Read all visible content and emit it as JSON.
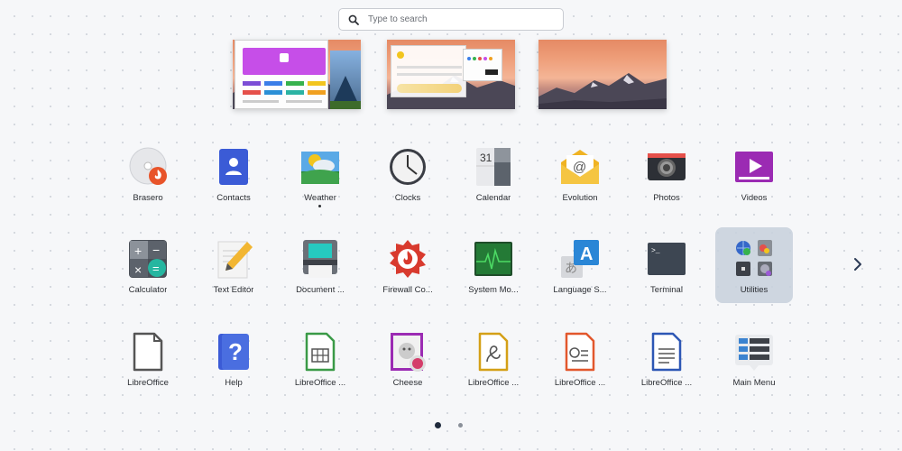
{
  "search": {
    "placeholder": "Type to search"
  },
  "page_indicator": {
    "current": 1,
    "total": 2
  },
  "rows": [
    [
      {
        "name": "Brasero"
      },
      {
        "name": "Contacts"
      },
      {
        "name": "Weather",
        "running": true
      },
      {
        "name": "Clocks"
      },
      {
        "name": "Calendar"
      },
      {
        "name": "Evolution"
      },
      {
        "name": "Photos"
      },
      {
        "name": "Videos"
      }
    ],
    [
      {
        "name": "Calculator"
      },
      {
        "name": "Text Editor"
      },
      {
        "name": "Document ..."
      },
      {
        "name": "Firewall Co..."
      },
      {
        "name": "System Mo..."
      },
      {
        "name": "Language S..."
      },
      {
        "name": "Terminal"
      },
      {
        "name": "Utilities",
        "selected": true
      }
    ],
    [
      {
        "name": "LibreOffice"
      },
      {
        "name": "Help"
      },
      {
        "name": "LibreOffice ..."
      },
      {
        "name": "Cheese"
      },
      {
        "name": "LibreOffice ..."
      },
      {
        "name": "LibreOffice ..."
      },
      {
        "name": "LibreOffice ..."
      },
      {
        "name": "Main Menu"
      }
    ]
  ],
  "colors": {
    "accent": "#1f2a3c",
    "selection": "#c7d0dc",
    "background": "#f6f7f9"
  }
}
